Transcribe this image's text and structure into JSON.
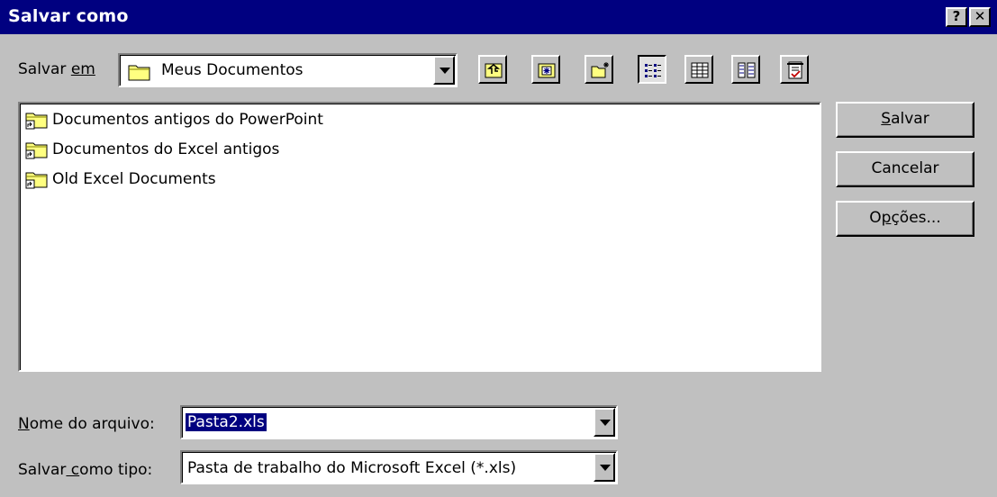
{
  "window": {
    "title": "Salvar como",
    "help_glyph": "?",
    "close_glyph": "✕"
  },
  "location": {
    "label_pre": "Salvar ",
    "label_ul": "em",
    "value": "Meus Documentos"
  },
  "toolbar": {
    "icons": [
      "up-one-level-icon",
      "desktop-icon",
      "new-folder-icon",
      "list-view-icon",
      "details-view-icon",
      "properties-view-icon",
      "commands-icon"
    ]
  },
  "files": [
    {
      "name": "Documentos antigos do PowerPoint",
      "icon": "folder-shortcut-icon"
    },
    {
      "name": "Documentos do Excel antigos",
      "icon": "folder-shortcut-icon"
    },
    {
      "name": "Old Excel Documents",
      "icon": "folder-shortcut-icon"
    }
  ],
  "buttons": {
    "save_ul": "S",
    "save_rest": "alvar",
    "cancel": "Cancelar",
    "options_pre": "O",
    "options_ul": "p",
    "options_rest": "ções..."
  },
  "filename": {
    "label_ul": "N",
    "label_rest": "ome do arquivo:",
    "value": "Pasta2.xls"
  },
  "filetype": {
    "label_pre": "Salvar",
    "label_ul": " c",
    "label_rest": "omo tipo:",
    "value": "Pasta de trabalho do Microsoft Excel (*.xls)"
  },
  "colors": {
    "titlebar": "#000080",
    "face": "#c0c0c0",
    "selection": "#000080",
    "folder": "#ffff80"
  }
}
